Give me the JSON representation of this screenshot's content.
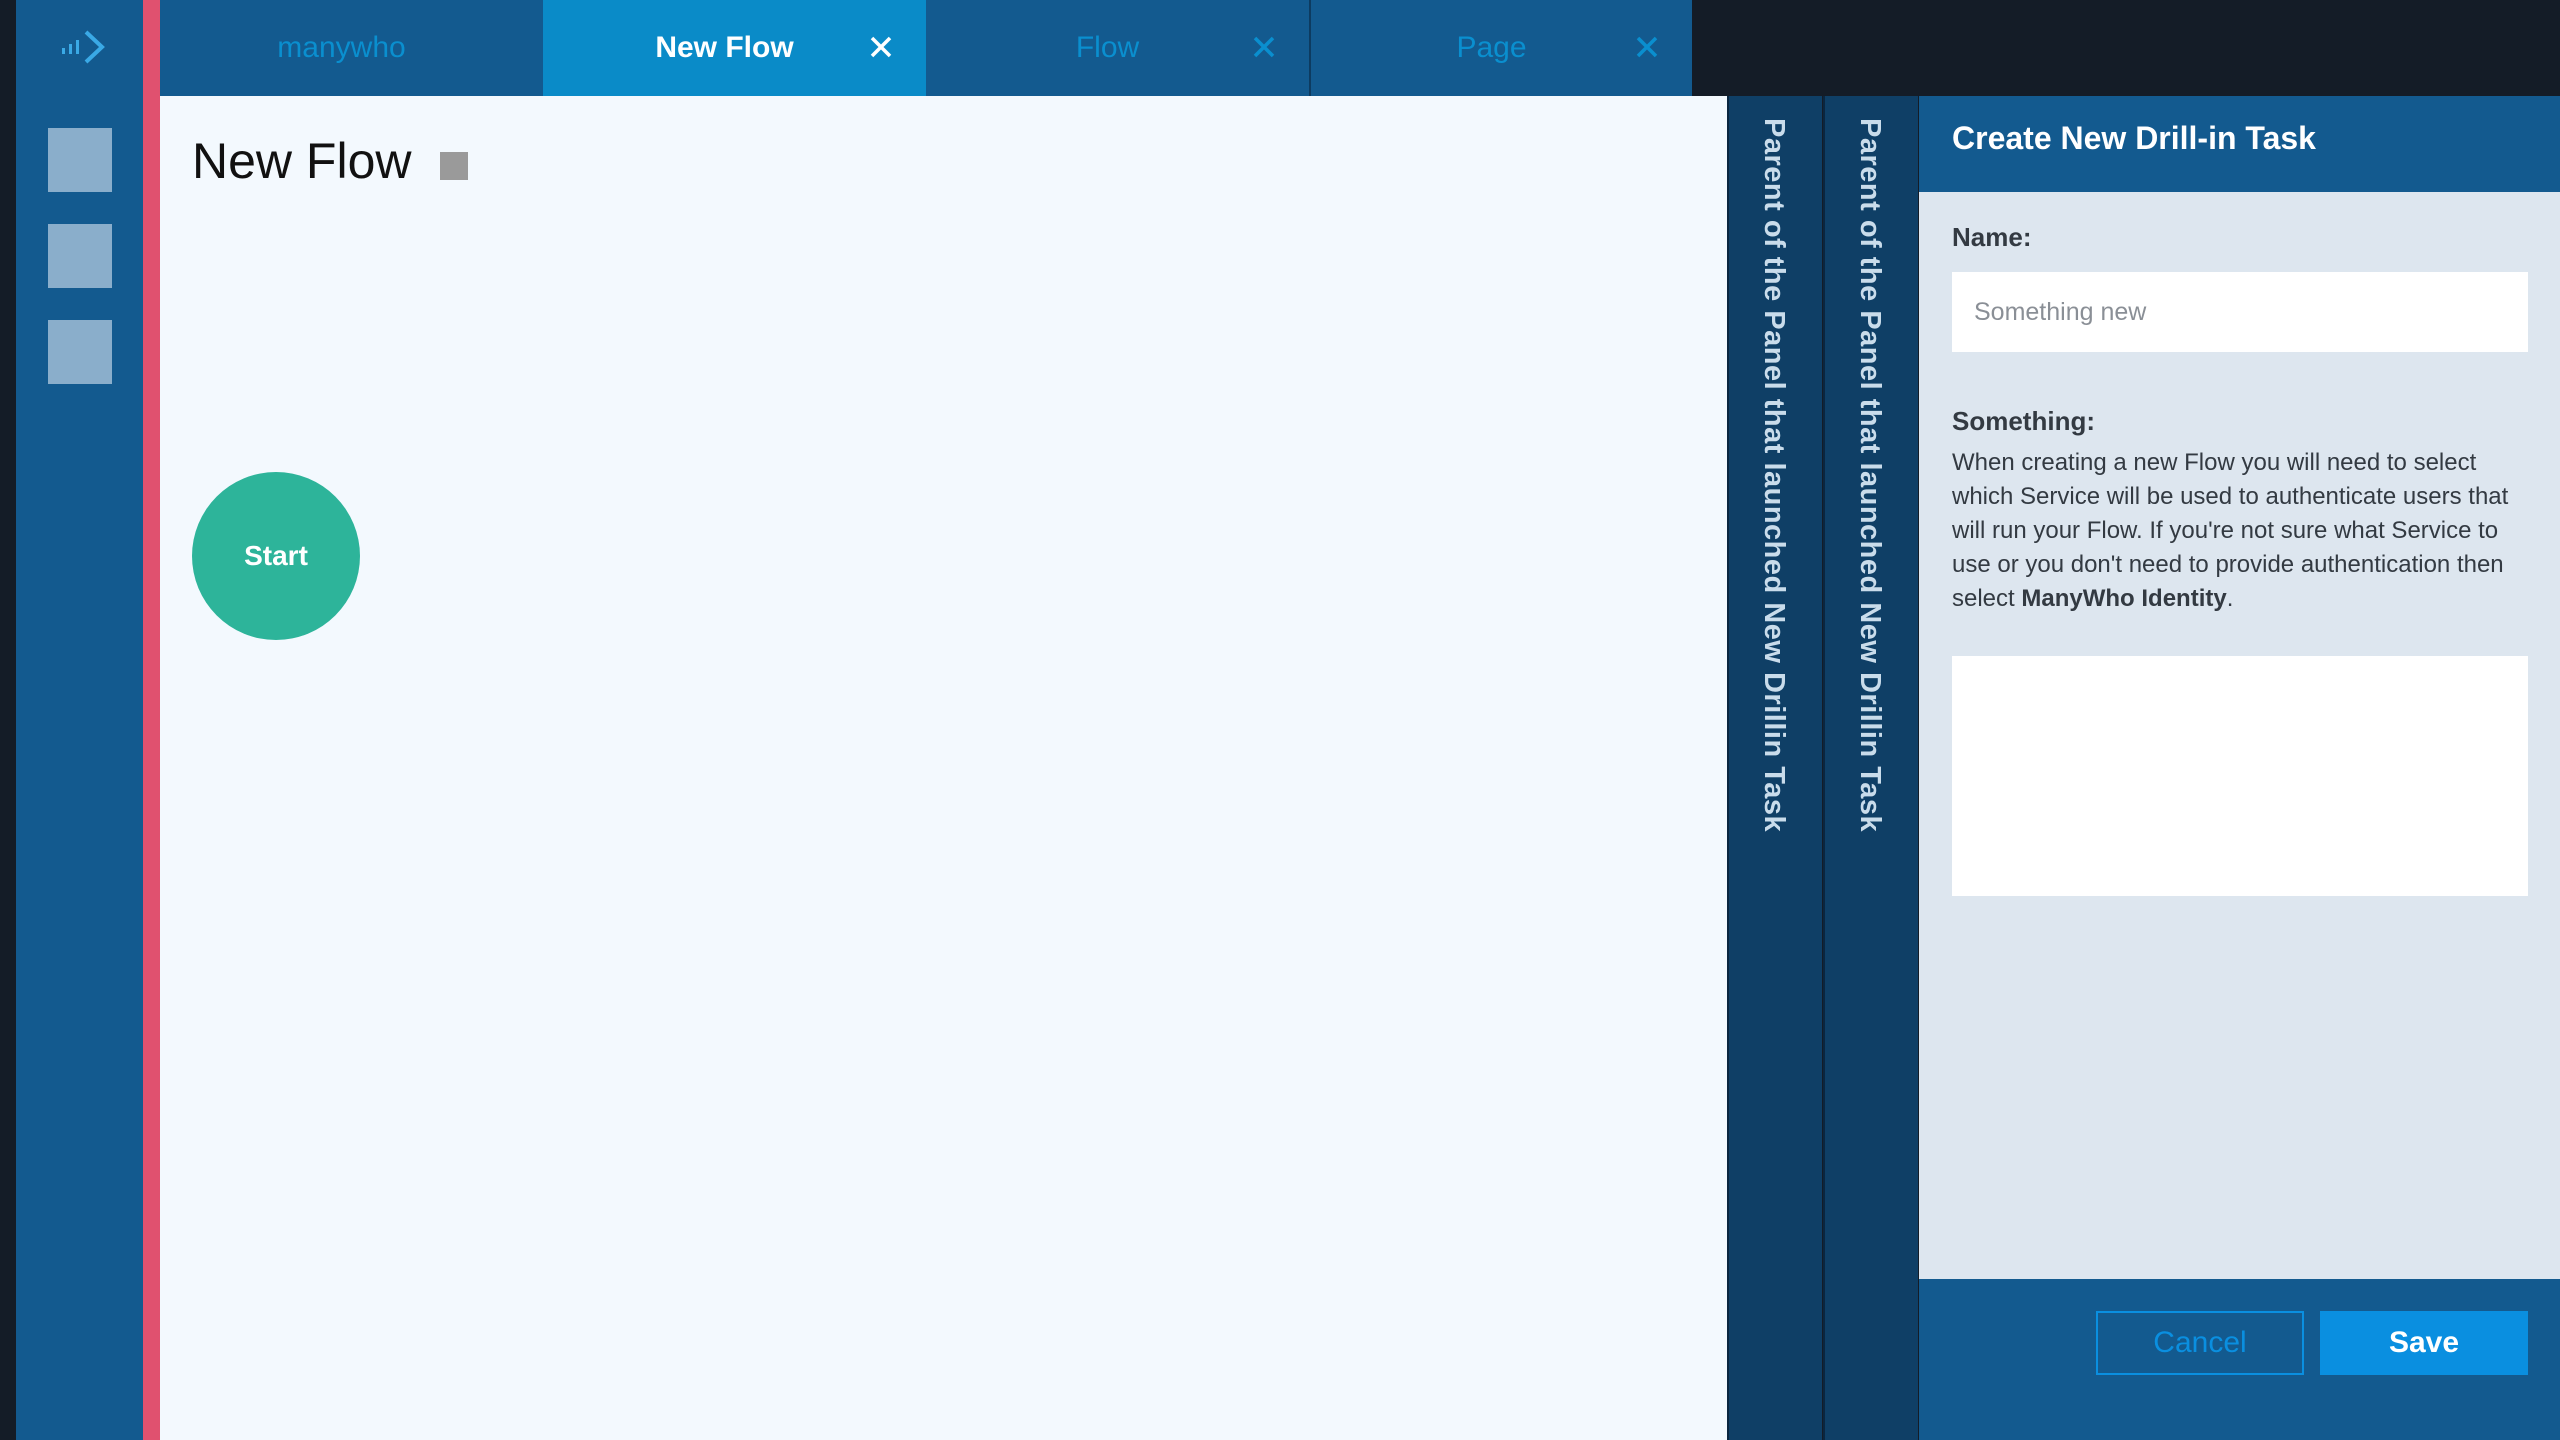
{
  "tabs": [
    {
      "label": "manywho",
      "active": false,
      "closable": false
    },
    {
      "label": "New Flow",
      "active": true,
      "closable": true
    },
    {
      "label": "Flow",
      "active": false,
      "closable": true
    },
    {
      "label": "Page",
      "active": false,
      "closable": true
    }
  ],
  "canvas": {
    "title": "New Flow",
    "start_node_label": "Start"
  },
  "collapsed_panels": [
    {
      "label": "Parent of the Panel that launched New Drillin Task"
    },
    {
      "label": "Parent of the Panel that launched New Drillin Task"
    }
  ],
  "drawer": {
    "title": "Create New Drill-in Task",
    "name_label": "Name:",
    "name_placeholder": "Something new",
    "something_label": "Something:",
    "help_text_before": "When creating a new Flow you will need to select which Service will be used to authenticate users that will run your Flow. If you're not sure what Service to use or you don't need to provide authentication then select ",
    "help_text_bold": "ManyWho Identity",
    "help_text_after": ".",
    "textarea_value": "",
    "cancel_label": "Cancel",
    "save_label": "Save"
  },
  "colors": {
    "rail": "#135a8f",
    "accent": "#e0516f",
    "active_tab": "#0a8bc8",
    "start_node": "#2db49a",
    "primary_button": "#0a8fe0"
  },
  "icons": {
    "logo": "manywho-logo-icon",
    "tab_close": "close-icon"
  }
}
